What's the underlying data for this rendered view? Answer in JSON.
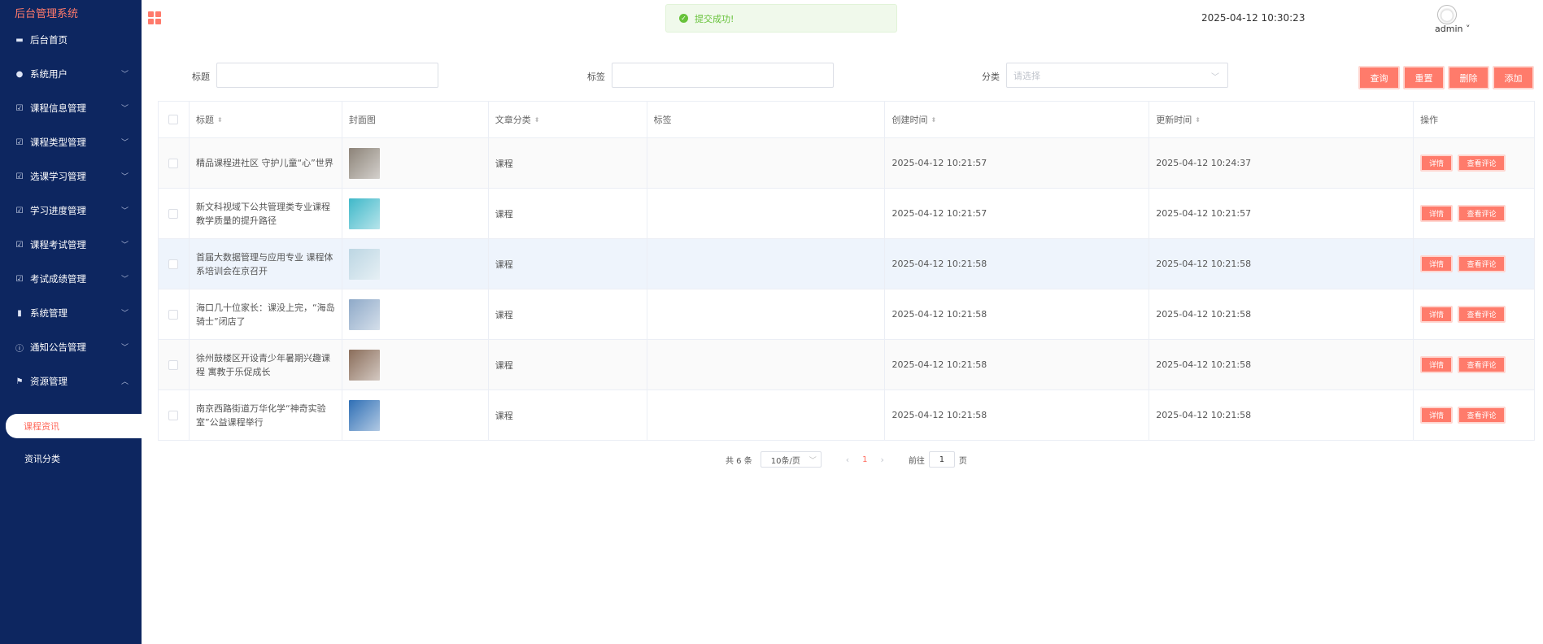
{
  "app": {
    "brand": "后台管理系统",
    "datetime": "2025-04-12 10:30:23",
    "user": "admin",
    "toast": "提交成功!"
  },
  "sidebar": {
    "items": [
      {
        "label": "后台首页",
        "icon": "monitor-icon",
        "has_caret": false
      },
      {
        "label": "系统用户",
        "icon": "user-icon",
        "has_caret": true
      },
      {
        "label": "课程信息管理",
        "icon": "checkbox-icon",
        "has_caret": true
      },
      {
        "label": "课程类型管理",
        "icon": "checkbox-icon",
        "has_caret": true
      },
      {
        "label": "选课学习管理",
        "icon": "checkbox-icon",
        "has_caret": true
      },
      {
        "label": "学习进度管理",
        "icon": "checkbox-icon",
        "has_caret": true
      },
      {
        "label": "课程考试管理",
        "icon": "checkbox-icon",
        "has_caret": true
      },
      {
        "label": "考试成绩管理",
        "icon": "checkbox-icon",
        "has_caret": true
      },
      {
        "label": "系统管理",
        "icon": "bar-chart-icon",
        "has_caret": true
      },
      {
        "label": "通知公告管理",
        "icon": "info-icon",
        "has_caret": true
      },
      {
        "label": "资源管理",
        "icon": "flag-icon",
        "has_caret": true,
        "expanded": true
      }
    ],
    "sub_items": [
      {
        "label": "课程资讯",
        "active": true
      },
      {
        "label": "资讯分类",
        "active": false
      }
    ]
  },
  "search": {
    "title_label": "标题",
    "title_value": "",
    "tag_label": "标签",
    "tag_value": "",
    "category_label": "分类",
    "category_placeholder": "请选择",
    "buttons": {
      "query": "查询",
      "reset": "重置",
      "delete": "删除",
      "add": "添加"
    }
  },
  "table": {
    "headers": [
      "标题",
      "封面图",
      "文章分类",
      "标签",
      "创建时间",
      "更新时间",
      "操作"
    ],
    "rows": [
      {
        "title": "精品课程进社区 守护儿童“心”世界",
        "category": "课程",
        "tag": "",
        "created": "2025-04-12 10:21:57",
        "updated": "2025-04-12 10:24:37",
        "thumb_color": "#8c8378"
      },
      {
        "title": "新文科视域下公共管理类专业课程教学质量的提升路径",
        "category": "课程",
        "tag": "",
        "created": "2025-04-12 10:21:57",
        "updated": "2025-04-12 10:21:57",
        "thumb_color": "#3fb8c9"
      },
      {
        "title": "首届大数据管理与应用专业 课程体系培训会在京召开",
        "category": "课程",
        "tag": "",
        "created": "2025-04-12 10:21:58",
        "updated": "2025-04-12 10:21:58",
        "thumb_color": "#bcd6e3"
      },
      {
        "title": "海口几十位家长：课没上完，“海岛骑士”闭店了",
        "category": "课程",
        "tag": "",
        "created": "2025-04-12 10:21:58",
        "updated": "2025-04-12 10:21:58",
        "thumb_color": "#8ea9c8"
      },
      {
        "title": "徐州鼓楼区开设青少年暑期兴趣课程 寓教于乐促成长",
        "category": "课程",
        "tag": "",
        "created": "2025-04-12 10:21:58",
        "updated": "2025-04-12 10:21:58",
        "thumb_color": "#8a6d5a"
      },
      {
        "title": "南京西路街道万华化学“神奇实验室”公益课程举行",
        "category": "课程",
        "tag": "",
        "created": "2025-04-12 10:21:58",
        "updated": "2025-04-12 10:21:58",
        "thumb_color": "#2f6fb5"
      }
    ],
    "row_actions": {
      "detail": "详情",
      "comments": "查看评论"
    }
  },
  "pagination": {
    "total_text": "共 6 条",
    "page_size": "10条/页",
    "current_page": "1",
    "goto_label": "前往",
    "goto_value": "1",
    "page_suffix": "页"
  }
}
